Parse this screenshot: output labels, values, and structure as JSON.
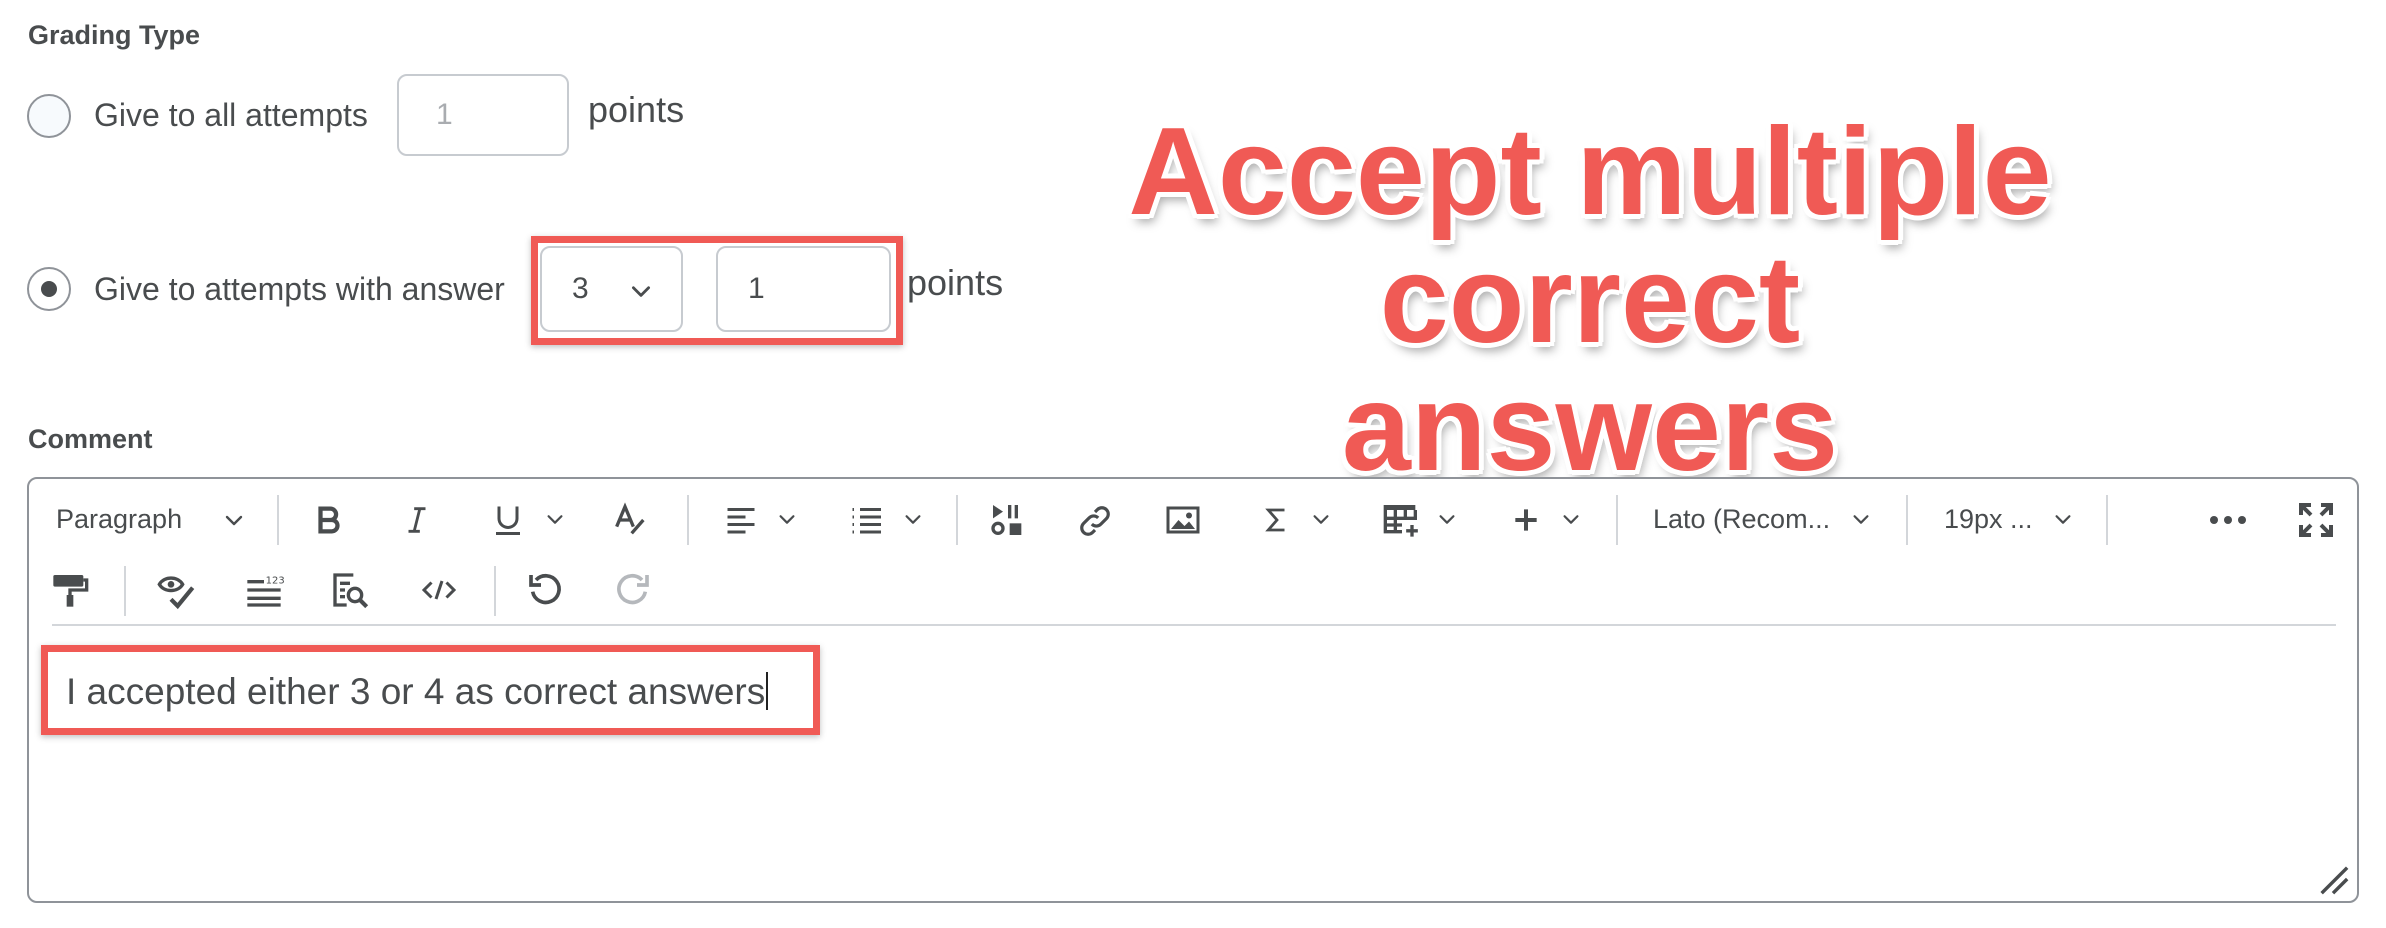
{
  "grading": {
    "title": "Grading Type",
    "option_all": {
      "label": "Give to all attempts",
      "placeholder": "1",
      "points_label": "points",
      "selected": false
    },
    "option_answer": {
      "label": "Give to attempts with answer",
      "answer_value": "3",
      "points_value": "1",
      "points_label": "points",
      "selected": true
    }
  },
  "annotation": {
    "line1": "Accept multiple",
    "line2": "correct answers"
  },
  "comment": {
    "title": "Comment",
    "toolbar": {
      "paragraph": "Paragraph",
      "font": "Lato (Recom...",
      "size": "19px ..."
    },
    "text": "I accepted either 3 or 4 as correct answers"
  },
  "colors": {
    "highlight": "#f05a55",
    "text": "#494c4e",
    "border": "#8f9399"
  },
  "icons": [
    "chevron-down-icon",
    "bold-icon",
    "italic-icon",
    "underline-icon",
    "clear-format-icon",
    "align-icon",
    "list-icon",
    "media-icon",
    "link-icon",
    "image-icon",
    "sigma-icon",
    "table-icon",
    "plus-icon",
    "more-icon",
    "fullscreen-icon",
    "format-painter-icon",
    "accessibility-check-icon",
    "line-numbers-icon",
    "find-replace-icon",
    "source-code-icon",
    "undo-icon",
    "redo-icon",
    "resize-handle-icon"
  ]
}
